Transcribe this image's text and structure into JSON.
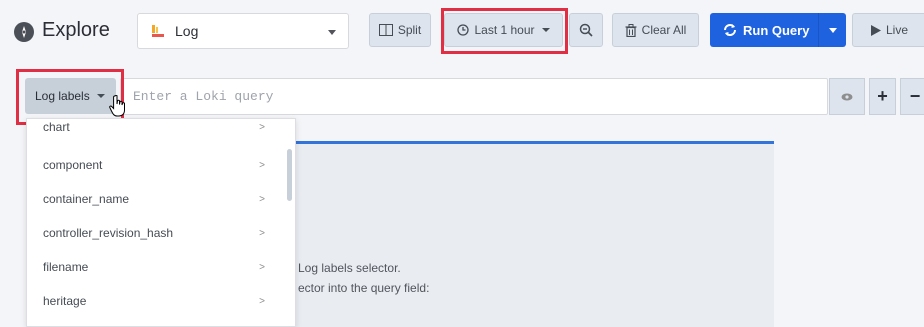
{
  "header": {
    "title": "Explore",
    "datasource": "Log"
  },
  "toolbar": {
    "split_label": "Split",
    "time_label": "Last 1 hour",
    "clear_label": "Clear All",
    "run_label": "Run Query",
    "live_label": "Live"
  },
  "query": {
    "labels_button": "Log labels",
    "placeholder": "Enter a Loki query"
  },
  "dropdown": {
    "items": [
      {
        "label": "chart",
        "chevron": ">"
      },
      {
        "label": "component",
        "chevron": ">"
      },
      {
        "label": "container_name",
        "chevron": ">"
      },
      {
        "label": "controller_revision_hash",
        "chevron": ">"
      },
      {
        "label": "filename",
        "chevron": ">"
      },
      {
        "label": "heritage",
        "chevron": ">"
      }
    ]
  },
  "help": {
    "line1": "Log labels selector.",
    "line2": "ector into the query field:"
  },
  "colors": {
    "accent": "#1f62e0",
    "highlight": "#e02f44",
    "panel_border": "#3274d9"
  }
}
